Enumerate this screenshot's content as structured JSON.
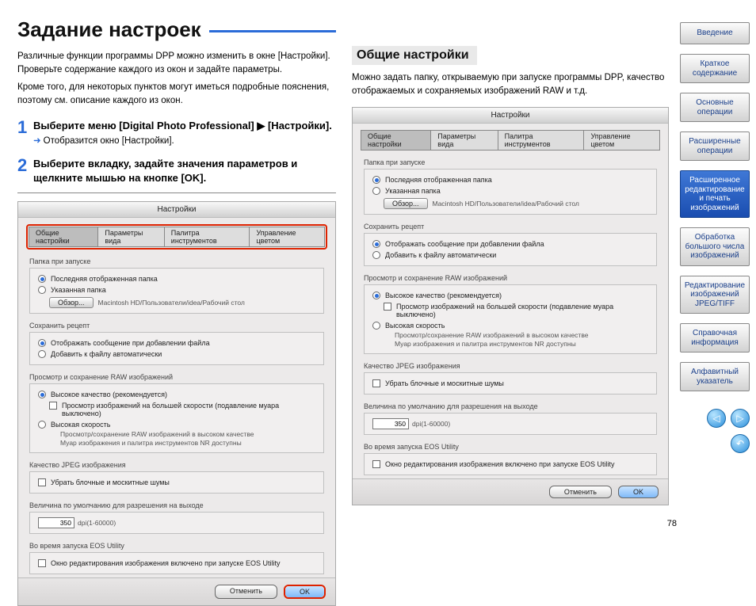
{
  "page_number": "78",
  "left": {
    "title": "Задание настроек",
    "intro1": "Различные функции программы DPP можно изменить в окне [Настройки]. Проверьте содержание каждого из окон и задайте параметры.",
    "intro2": "Кроме того, для некоторых пунктов могут иметься подробные пояснения, поэтому см. описание каждого из окон.",
    "step1_num": "1",
    "step1_title": "Выберите меню [Digital Photo Professional]  ▶ [Настройки].",
    "step1_sub": "Отобразится окно [Настройки].",
    "step2_num": "2",
    "step2_title": "Выберите вкладку, задайте значения параметров и щелкните мышью на кнопке [OK]."
  },
  "right": {
    "title": "Общие настройки",
    "intro": "Можно задать папку, открываемую при запуске программы DPP, качество отображаемых и сохраняемых изображений RAW и т.д."
  },
  "dialog": {
    "title": "Настройки",
    "tabs": {
      "t1": "Общие настройки",
      "t2": "Параметры вида",
      "t3": "Палитра инструментов",
      "t4": "Управление цветом"
    },
    "g_startup": {
      "title": "Папка при запуске",
      "r1": "Последняя отображенная папка",
      "r2": "Указанная папка",
      "browse": "Обзор...",
      "path": "Macintosh HD/Пользователи/idea/Рабочий стол"
    },
    "g_recipe": {
      "title": "Сохранить рецепт",
      "c1": "Отображать сообщение при добавлении файла",
      "c2": "Добавить к файлу автоматически"
    },
    "g_raw": {
      "title": "Просмотр и сохранение RAW изображений",
      "r1": "Высокое качество (рекомендуется)",
      "c1": "Просмотр изображений на большей скорости (подавление муара выключено)",
      "r2": "Высокая скорость",
      "n1": "Просмотр/сохранение RAW изображений в высоком качестве",
      "n2": "Муар изображения и палитра инструментов NR доступны"
    },
    "g_jpeg": {
      "title": "Качество JPEG изображения",
      "c1": "Убрать блочные и москитные шумы"
    },
    "g_res": {
      "title": "Величина по умолчанию для разрешения на выходе",
      "val": "350",
      "unit": "dpi(1-60000)"
    },
    "g_eos": {
      "title": "Во время запуска EOS Utility",
      "c1": "Окно редактирования изображения включено при запуске EOS Utility"
    },
    "btn_cancel": "Отменить",
    "btn_ok": "OK"
  },
  "sidebar": {
    "b1": "Введение",
    "b2": "Краткое содержание",
    "b3": "Основные операции",
    "b4": "Расширенные операции",
    "b5": "Расширенное редактирование и печать изображений",
    "b6": "Обработка большого числа изображений",
    "b7": "Редактирование изображений JPEG/TIFF",
    "b8": "Справочная информация",
    "b9": "Алфавитный указатель"
  }
}
